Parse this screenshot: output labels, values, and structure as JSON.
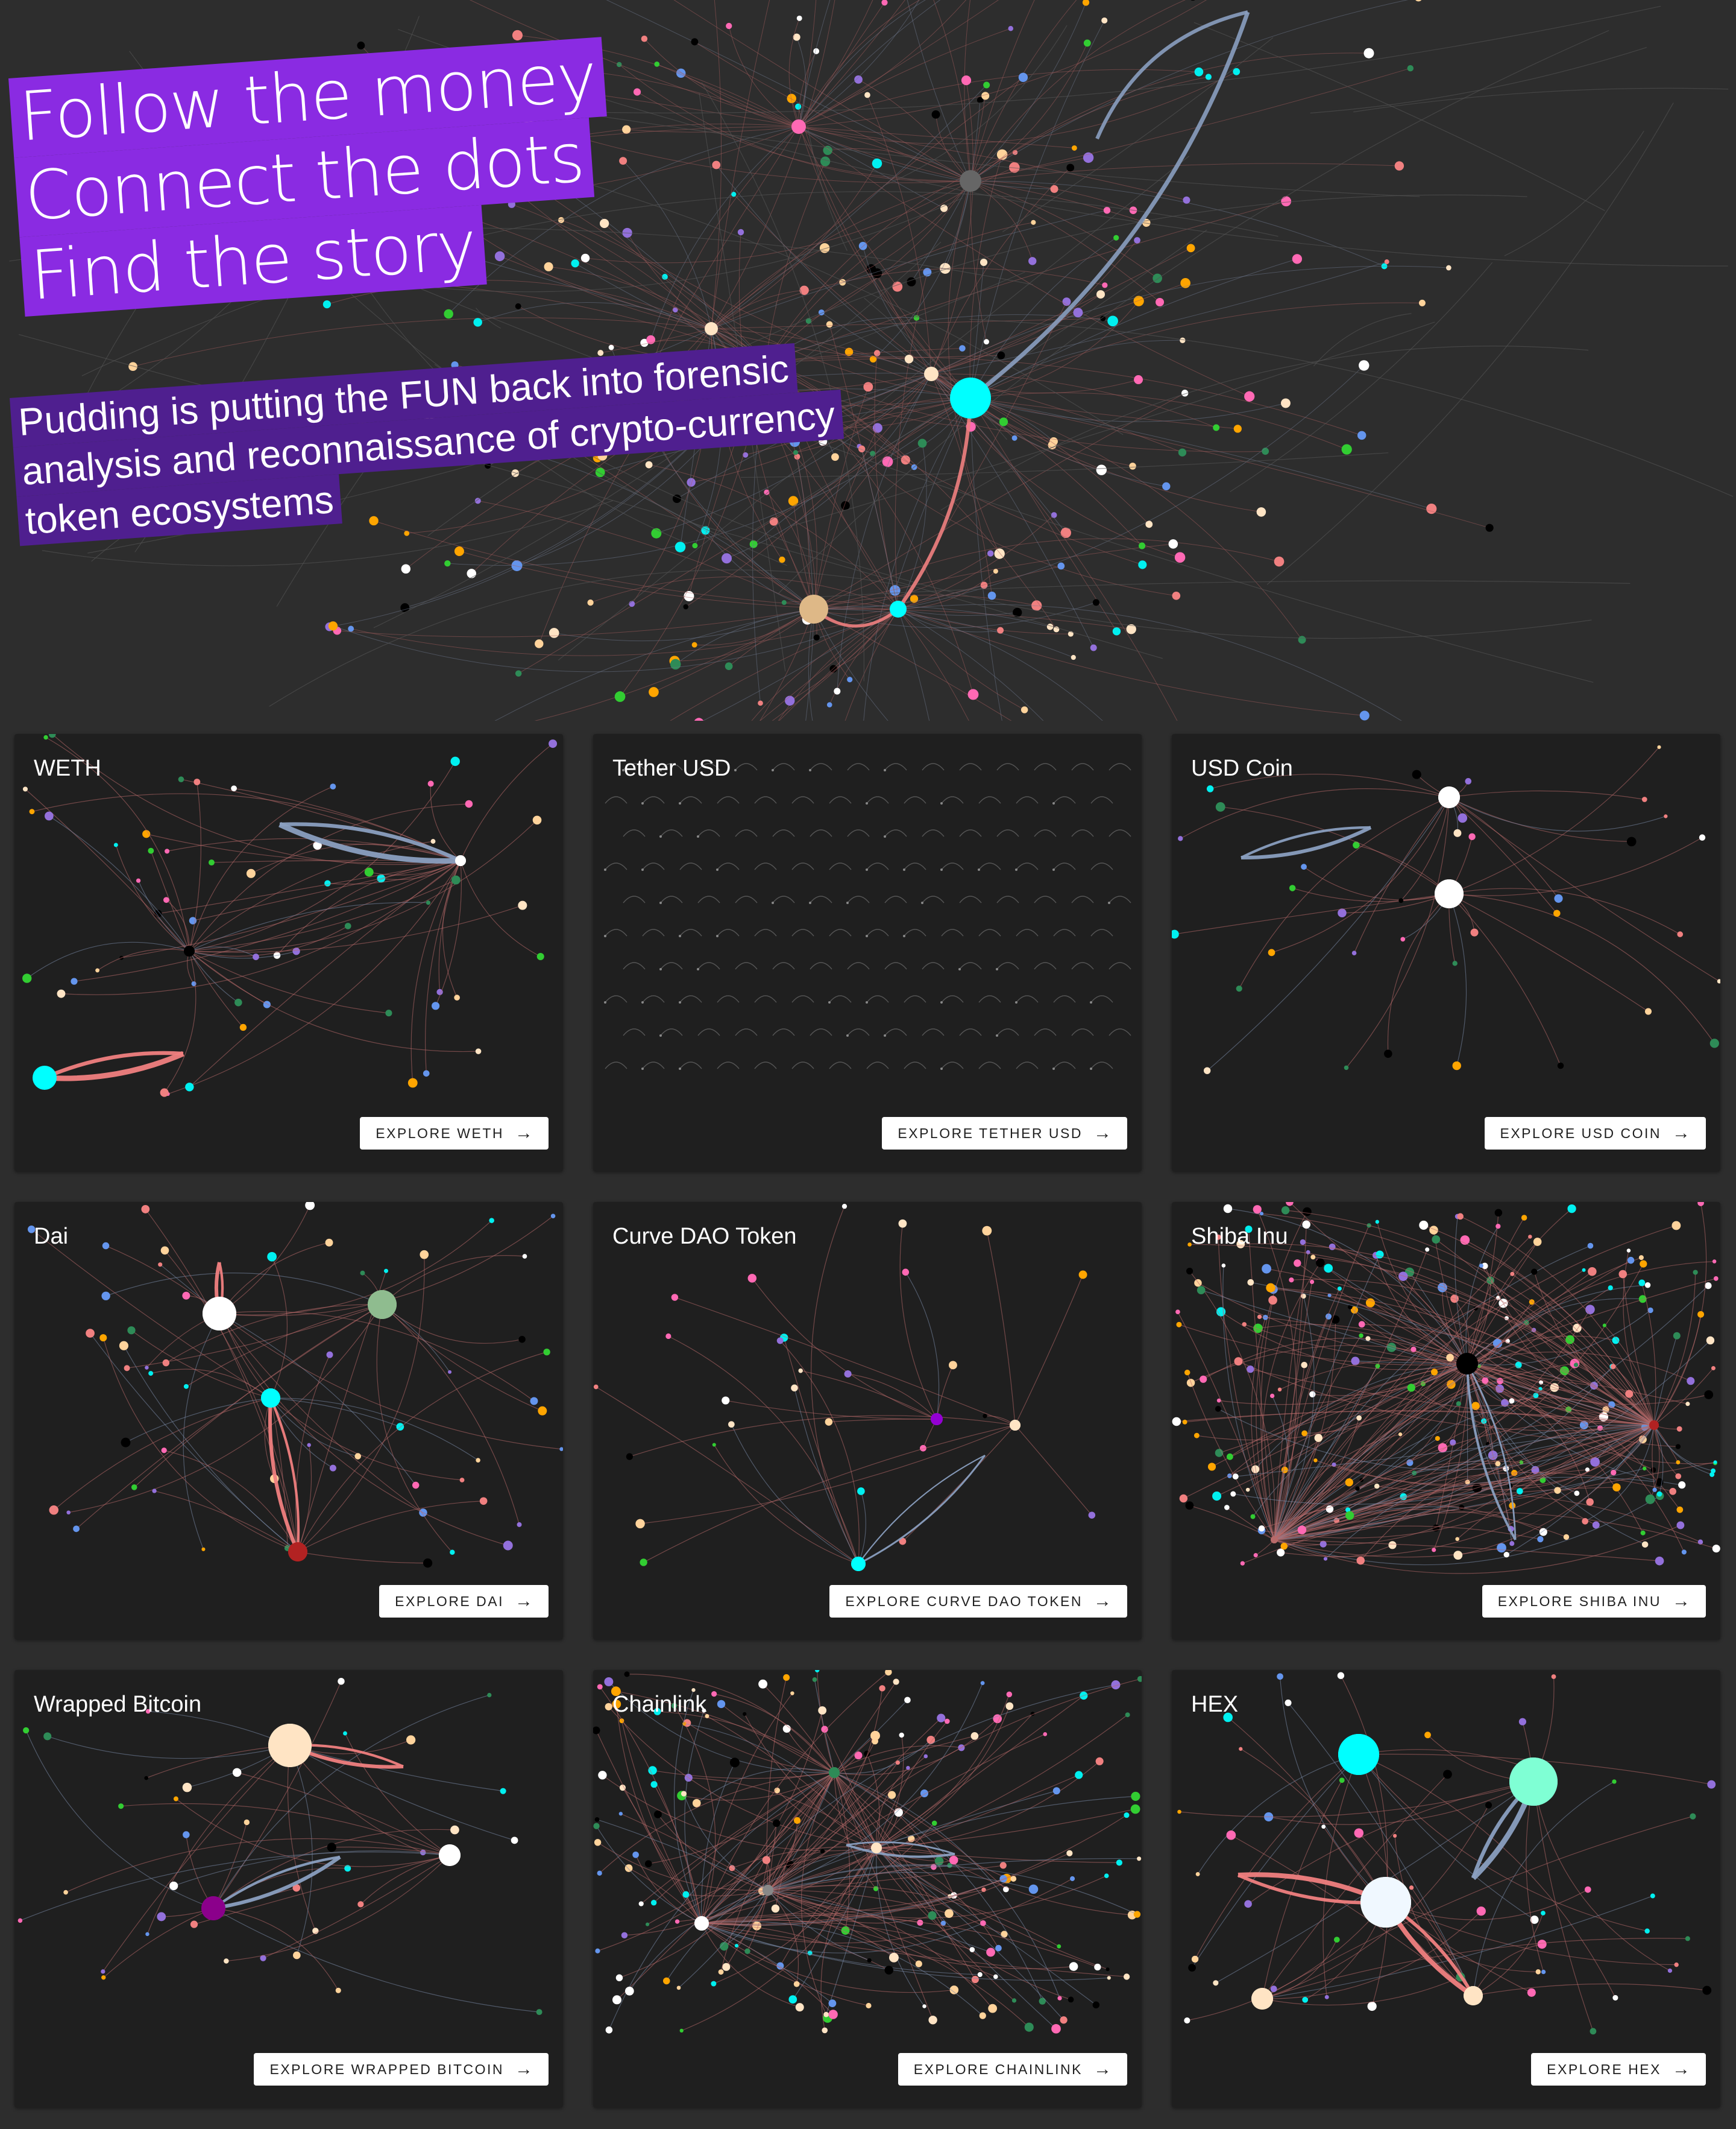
{
  "hero": {
    "headline": [
      "Follow the money",
      "Connect the dots",
      "Find the story"
    ],
    "subheadline": [
      "Pudding is putting the FUN back into forensic",
      "analysis and reconnaissance of crypto-currency",
      "token ecosystems"
    ]
  },
  "cards": [
    {
      "title": "WETH",
      "button": "EXPLORE WETH"
    },
    {
      "title": "Tether USD",
      "button": "EXPLORE TETHER USD"
    },
    {
      "title": "USD Coin",
      "button": "EXPLORE USD COIN"
    },
    {
      "title": "Dai",
      "button": "EXPLORE DAI"
    },
    {
      "title": "Curve DAO Token",
      "button": "EXPLORE CURVE DAO TOKEN"
    },
    {
      "title": "Shiba Inu",
      "button": "EXPLORE SHIBA INU"
    },
    {
      "title": "Wrapped Bitcoin",
      "button": "EXPLORE WRAPPED BITCOIN"
    },
    {
      "title": "Chainlink",
      "button": "EXPLORE CHAINLINK"
    },
    {
      "title": "HEX",
      "button": "EXPLORE HEX"
    }
  ],
  "icons": {
    "arrow": "→"
  },
  "colors": {
    "page_bg": "#2d2d2d",
    "card_bg": "#1f1f1f",
    "headline_bg": "#8a2be2",
    "subheadline_bg": "#4f1f8f",
    "flow_out": "#f08080",
    "flow_in": "#8a9fc0"
  }
}
